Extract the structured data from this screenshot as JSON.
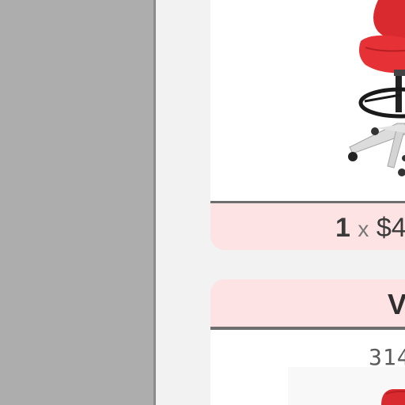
{
  "sidebar": {
    "background": "#adadad"
  },
  "cards": [
    {
      "image_icon": "red-stool-chair-icon",
      "price": {
        "quantity": "1",
        "separator": "x",
        "amount": "$4"
      }
    },
    {
      "title": "V",
      "subtitle": "314",
      "image_icon": "red-chair-icon"
    }
  ],
  "colors": {
    "card_tint": "#fde3e3",
    "product_red": "#e02a2f"
  }
}
